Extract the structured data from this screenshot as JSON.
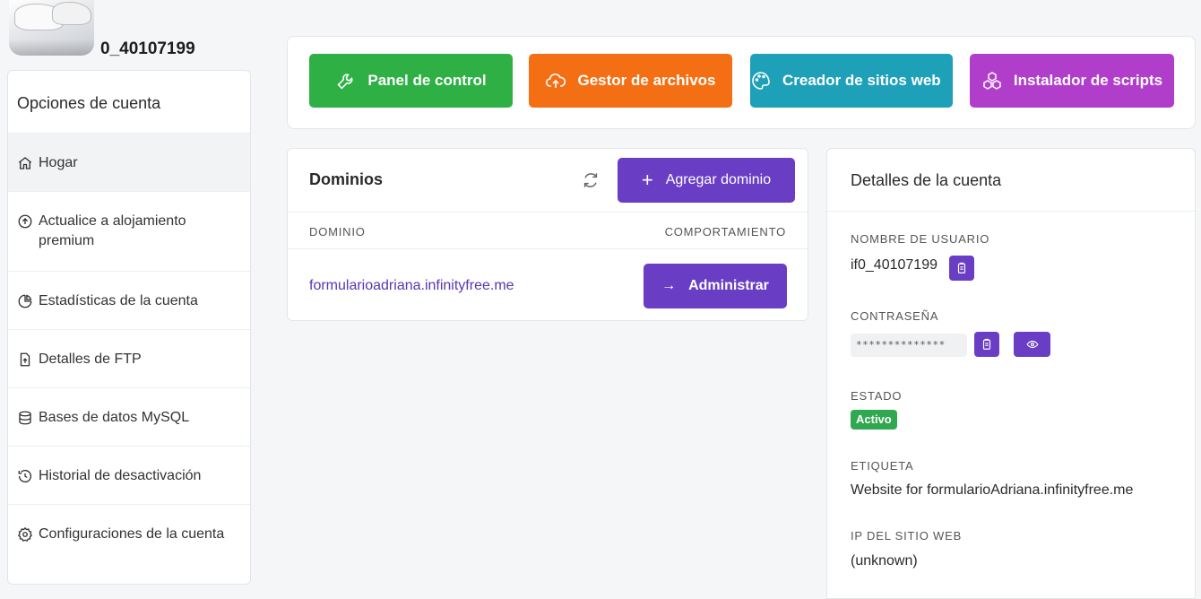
{
  "user": {
    "username_display": "0_40107199"
  },
  "sidebar": {
    "header": "Opciones de cuenta",
    "items": [
      {
        "label": "Hogar",
        "icon": "home-icon",
        "active": true
      },
      {
        "label": "Actualice a alojamiento premium",
        "icon": "arrow-up-circle-icon"
      },
      {
        "label": "Estadísticas de la cuenta",
        "icon": "pie-chart-icon"
      },
      {
        "label": "Detalles de FTP",
        "icon": "file-upload-icon"
      },
      {
        "label": "Bases de datos MySQL",
        "icon": "database-icon"
      },
      {
        "label": "Historial de desactivación",
        "icon": "history-icon"
      },
      {
        "label": "Configuraciones de la cuenta",
        "icon": "gear-icon"
      }
    ]
  },
  "quick_actions": [
    {
      "label": "Panel de control",
      "icon": "wrench-icon",
      "color": "#2fb044"
    },
    {
      "label": "Gestor de archivos",
      "icon": "cloud-upload-icon",
      "color": "#f46f14"
    },
    {
      "label": "Creador de sitios web",
      "icon": "palette-icon",
      "color": "#1ea0b8"
    },
    {
      "label": "Instalador de scripts",
      "icon": "boxes-icon",
      "color": "#b13ecb"
    }
  ],
  "domains": {
    "title": "Dominios",
    "add_label": "Agregar dominio",
    "col_domain": "DOMINIO",
    "col_behavior": "COMPORTAMIENTO",
    "rows": [
      {
        "domain": "formularioadriana.infinityfree.me",
        "action": "Administrar"
      }
    ]
  },
  "account_details": {
    "title": "Detalles de la cuenta",
    "username_label": "NOMBRE DE USUARIO",
    "username": "if0_40107199",
    "password_label": "CONTRASEÑA",
    "password_masked": "**************",
    "status_label": "ESTADO",
    "status": "Activo",
    "tag_label": "ETIQUETA",
    "tag": "Website for formularioAdriana.infinityfree.me",
    "ip_label": "IP DEL SITIO WEB",
    "ip": "(unknown)"
  },
  "colors": {
    "accent": "#6a3ec4",
    "status_active": "#2fa84f",
    "link": "#5a35b0"
  }
}
